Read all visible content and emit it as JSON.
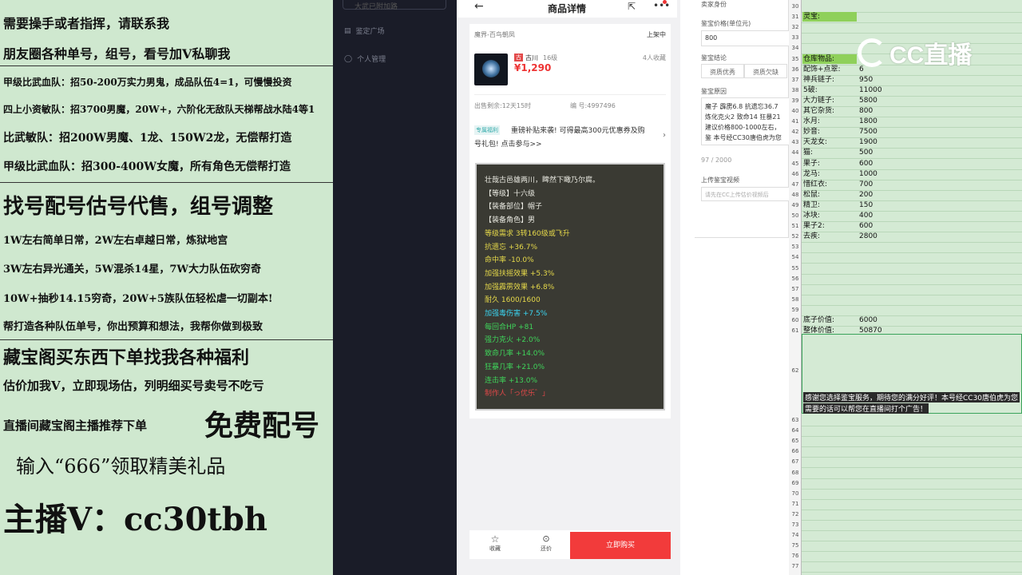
{
  "ad": {
    "lines": [
      "需要操手或者指挥，请联系我",
      "朋友圈各种单号，组号，看号加Ⅴ私聊我",
      "甲级比武血队：招50-200万实力男鬼，成品队伍4=1，可慢慢投资",
      "四上小资敏队：招3700男魔，20W+，六阶化无敌队天梯帮战水陆4等1",
      "比武敏队：招200W男魔、1龙、150W2龙，无偿帮打造",
      "甲级比武血队：招300-400W女魔，所有角色无偿帮打造",
      "找号配号估号代售，组号调整",
      "1W左右简单日常，2W左右卓越日常，炼狱地宫",
      "3W左右异光通关，5W混杀14星，7W大力队伍砍穷奇",
      "10W+抽秒14.15穷奇，20W+5族队伍轻松虐一切副本!",
      "帮打造各种队伍单号，你出预算和想法，我帮你做到极致",
      "藏宝阁买东西下单找我各种福利",
      "估价加我Ⅴ，立即现场估，列明细买号卖号不吃亏",
      "直播间藏宝阁主播推荐下单",
      "免费配号",
      "输入“666”领取精美礼品",
      "主播Ⅴ：cc30tbh"
    ]
  },
  "sidebar": {
    "search": "大武已附加路",
    "items": [
      {
        "icon": "appraise-icon",
        "label": "鉴定广场"
      },
      {
        "icon": "user-icon",
        "label": "个人管理"
      }
    ]
  },
  "phone": {
    "title": "商品详情",
    "server": "魔界-百鸟朝凤",
    "status": "上架中",
    "seller_tag": "古",
    "seller": "古川",
    "level": "16级",
    "favs": "4人收藏",
    "price": "¥1,290",
    "remain": "出售剩余:12天15时",
    "code": "编 号:4997496",
    "promo_tag": "专属福利",
    "promo": "重磅补贴来袭! 可得最高300元优惠券及购号礼包! 点击参与>>",
    "item_lines": [
      {
        "t": "壮哉古邑雄两川，睥然下瞰乃尔腐。",
        "c": "#e8e8e0"
      },
      {
        "t": "【等级】十六级",
        "c": "#e8e8e0"
      },
      {
        "t": "【装备部位】帽子",
        "c": "#e8e8e0"
      },
      {
        "t": "【装备角色】男",
        "c": "#e8e8e0"
      },
      {
        "t": "等级需求 3转160级或飞升",
        "c": "#e6d94a"
      },
      {
        "t": "抗遗忘 +36.7%",
        "c": "#e6d94a"
      },
      {
        "t": "命中率 -10.0%",
        "c": "#e6d94a"
      },
      {
        "t": "加强扶摇效果 +5.3%",
        "c": "#e6d94a"
      },
      {
        "t": "加强霹雳效果 +6.8%",
        "c": "#e6d94a"
      },
      {
        "t": "耐久 1600/1600",
        "c": "#e6d94a"
      },
      {
        "t": "加强毒伤害 +7.5%",
        "c": "#3ad4f0"
      },
      {
        "t": "每回合HP +81",
        "c": "#3fd45a"
      },
      {
        "t": "强力克火 +2.0%",
        "c": "#3fd45a"
      },
      {
        "t": "致命几率 +14.0%",
        "c": "#3fd45a"
      },
      {
        "t": "狂暴几率 +21.0%",
        "c": "#3fd45a"
      },
      {
        "t": "连击率 +13.0%",
        "c": "#3fd45a"
      },
      {
        "t": "制作人「っ优乐゛」",
        "c": "#e04848"
      }
    ],
    "bottom": {
      "fav": "收藏",
      "bargain": "还价",
      "buy": "立即购买"
    }
  },
  "form": {
    "seller_id": "卖家身份",
    "price_label": "鉴宝价格(单位元)",
    "price_value": "800",
    "conclusion_label": "鉴宝结论",
    "pros": "资质优秀",
    "cons": "资质欠缺",
    "reason_label": "鉴宝原因",
    "reason_text": "魔子 霹雳6.8 抗遗忘36.7 炼化克火2 致命14 狂暴21 建议价格800-1000左右，鉴 本号经CC30唐伯虎为您鉴",
    "count": "97 / 2000",
    "video_label": "上传鉴宝视频",
    "video_placeholder": "请先在CC上传估价视频后"
  },
  "sheet": {
    "rows": [
      30,
      31,
      32,
      33,
      34,
      35,
      36,
      37,
      38,
      39,
      40,
      41,
      42,
      43,
      44,
      45,
      46,
      47,
      48,
      49,
      50,
      51,
      52,
      53,
      54,
      55,
      56,
      57,
      58,
      59,
      60,
      61
    ],
    "cells": [
      {
        "row": 31,
        "a": "灵宝:",
        "b": "",
        "hl": true
      },
      {
        "row": 35,
        "a": "仓库物品:",
        "b": "",
        "hl": true
      },
      {
        "row": 36,
        "a": "配饰+点翠:",
        "b": "6"
      },
      {
        "row": 37,
        "a": "神兵链子:",
        "b": "950"
      },
      {
        "row": 38,
        "a": "5破:",
        "b": "11000"
      },
      {
        "row": 39,
        "a": "大力链子:",
        "b": "5800"
      },
      {
        "row": 40,
        "a": "其它杂货:",
        "b": "800"
      },
      {
        "row": 41,
        "a": "水月:",
        "b": "1800"
      },
      {
        "row": 42,
        "a": "妙音:",
        "b": "7500"
      },
      {
        "row": 43,
        "a": "天龙女:",
        "b": "1900"
      },
      {
        "row": 44,
        "a": "猫:",
        "b": "500"
      },
      {
        "row": 45,
        "a": "果子:",
        "b": "600"
      },
      {
        "row": 46,
        "a": "龙马:",
        "b": "1000"
      },
      {
        "row": 47,
        "a": "惜红衣:",
        "b": "700"
      },
      {
        "row": 48,
        "a": "松鼠:",
        "b": "200"
      },
      {
        "row": 49,
        "a": "精卫:",
        "b": "150"
      },
      {
        "row": 50,
        "a": "冰块:",
        "b": "400"
      },
      {
        "row": 51,
        "a": "果子2:",
        "b": "600"
      },
      {
        "row": 52,
        "a": "去疾:",
        "b": "2800"
      },
      {
        "row": 60,
        "a": "底子价值:",
        "b": "6000"
      },
      {
        "row": 61,
        "a": "整体价值:",
        "b": "50870"
      }
    ],
    "big_row": "62",
    "note1": "感谢您选择鉴宝服务，期待您的满分好评！本号经CC30唐伯虎为您",
    "note2": "需要的话可以帮您在直播间打个广告！",
    "rows2": [
      63,
      64,
      65,
      66,
      67,
      68,
      69,
      70,
      71,
      72,
      73,
      74,
      75,
      76,
      77
    ],
    "logo": "CC直播"
  }
}
